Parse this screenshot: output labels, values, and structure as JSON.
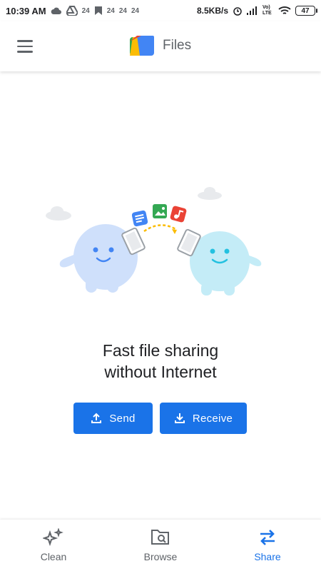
{
  "status_bar": {
    "time": "10:39 AM",
    "notif_counts": [
      "24",
      "24",
      "24",
      "24"
    ],
    "speed": "8.5KB/s",
    "network_label": "Vo) LTE",
    "battery": "47"
  },
  "app_bar": {
    "title": "Files",
    "menu_icon": "hamburger-menu-icon",
    "logo_icon": "files-app-logo"
  },
  "main": {
    "headline_line1": "Fast file sharing",
    "headline_line2": "without Internet",
    "send_label": "Send",
    "receive_label": "Receive"
  },
  "bottom_nav": {
    "items": [
      {
        "label": "Clean",
        "icon": "sparkle-icon",
        "active": false
      },
      {
        "label": "Browse",
        "icon": "folder-search-icon",
        "active": false
      },
      {
        "label": "Share",
        "icon": "swap-arrows-icon",
        "active": true
      }
    ]
  },
  "colors": {
    "accent": "#1a73e8",
    "text": "#202124",
    "muted": "#5f6368"
  }
}
